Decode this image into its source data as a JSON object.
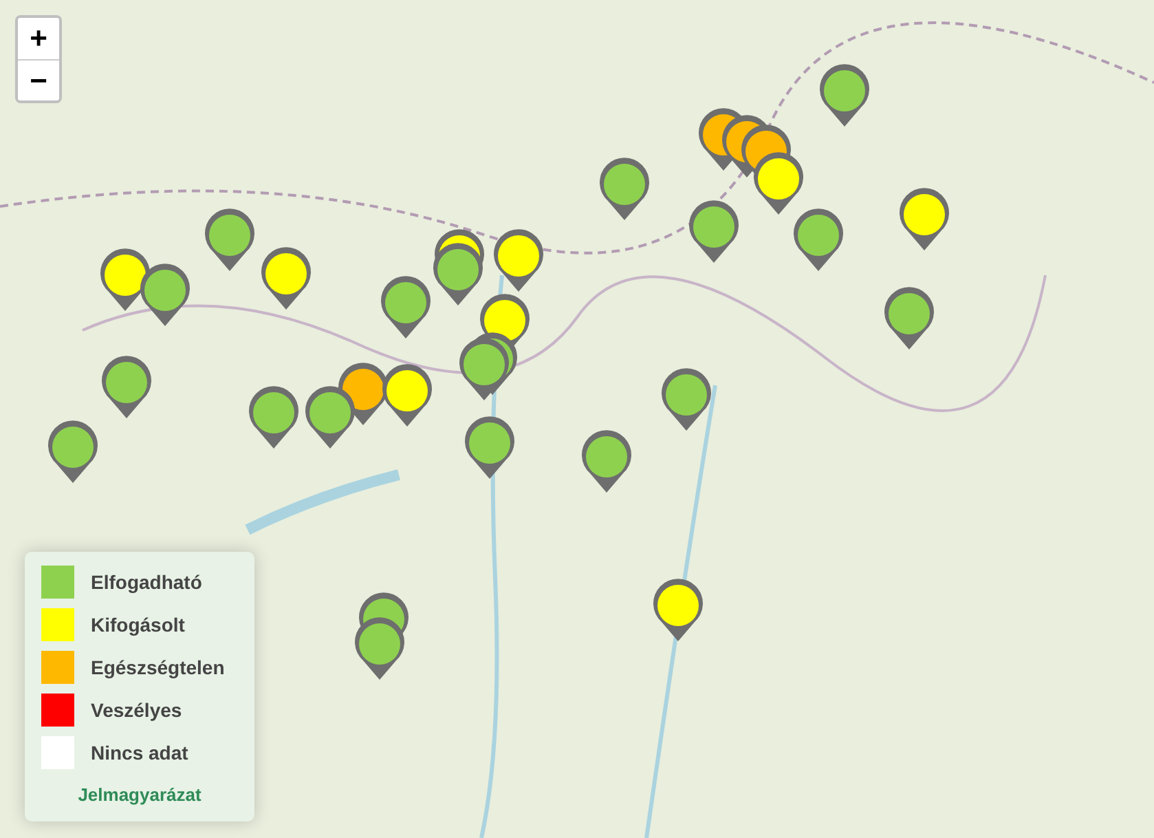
{
  "zoom_controls": [
    {
      "label": "+"
    },
    {
      "label": "−"
    }
  ],
  "markers": [
    {
      "color": "#8ed14f"
    },
    {
      "color": "#ffb800"
    },
    {
      "color": "#ffb800"
    },
    {
      "color": "#ffb800"
    },
    {
      "color": "#ffff00"
    },
    {
      "color": "#8ed14f"
    },
    {
      "color": "#ffff00"
    },
    {
      "color": "#8ed14f"
    },
    {
      "color": "#8ed14f"
    },
    {
      "color": "#8ed14f"
    },
    {
      "color": "#ffff00"
    },
    {
      "color": "#8ed14f"
    },
    {
      "color": "#ffff00"
    },
    {
      "color": "#ffff00"
    },
    {
      "color": "#8ed14f"
    },
    {
      "color": "#ffff00"
    },
    {
      "color": "#8ed14f"
    },
    {
      "color": "#ffff00"
    },
    {
      "color": "#8ed14f"
    },
    {
      "color": "#8ed14f"
    },
    {
      "color": "#8ed14f"
    },
    {
      "color": "#8ed14f"
    },
    {
      "color": "#ffb800"
    },
    {
      "color": "#ffff00"
    },
    {
      "color": "#8ed14f"
    },
    {
      "color": "#8ed14f"
    },
    {
      "color": "#8ed14f"
    },
    {
      "color": "#8ed14f"
    },
    {
      "color": "#8ed14f"
    },
    {
      "color": "#8ed14f"
    },
    {
      "color": "#ffff00"
    },
    {
      "color": "#8ed14f"
    },
    {
      "color": "#8ed14f"
    }
  ],
  "legend": {
    "items": [
      {
        "label": "Elfogadható",
        "color": "#8ed14f"
      },
      {
        "label": "Kifogásolt",
        "color": "#ffff00"
      },
      {
        "label": "Egészségtelen",
        "color": "#ffb800"
      },
      {
        "label": "Veszélyes",
        "color": "#ff0000"
      },
      {
        "label": "Nincs adat",
        "color": "#ffffff"
      }
    ],
    "title": "Jelmagyarázat"
  }
}
